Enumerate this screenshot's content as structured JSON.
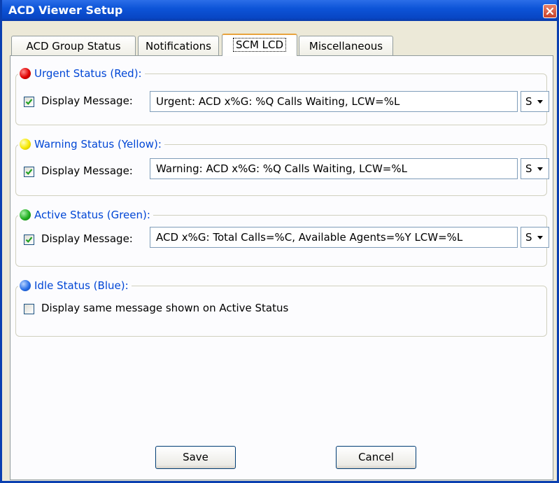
{
  "window": {
    "title": "ACD Viewer Setup"
  },
  "tabs": [
    {
      "label": "ACD Group Status"
    },
    {
      "label": "Notifications"
    },
    {
      "label": "SCM LCD"
    },
    {
      "label": "Miscellaneous"
    }
  ],
  "active_tab": "SCM LCD",
  "groups": {
    "urgent": {
      "legend": "Urgent Status (Red):",
      "checkbox_label": "Display Message:",
      "checked": true,
      "message": "Urgent: ACD x%G: %Q Calls Waiting, LCW=%L",
      "dropdown": "S"
    },
    "warning": {
      "legend": "Warning Status (Yellow):",
      "checkbox_label": "Display Message:",
      "checked": true,
      "message": "Warning: ACD x%G: %Q Calls Waiting, LCW=%L",
      "dropdown": "S"
    },
    "active": {
      "legend": "Active Status (Green):",
      "checkbox_label": "Display Message:",
      "checked": true,
      "message": "ACD x%G: Total Calls=%C, Available Agents=%Y LCW=%L",
      "dropdown": "S"
    },
    "idle": {
      "legend": "Idle Status (Blue):",
      "checkbox_label": "Display same message shown on Active Status",
      "checked": false
    }
  },
  "buttons": {
    "save": "Save",
    "cancel": "Cancel"
  },
  "colors": {
    "legend_text": "#0046d5",
    "titlebar": "#0d54d8",
    "red": "#e00000",
    "yellow": "#f6e800",
    "green": "#22b022",
    "blue": "#2a70e8"
  }
}
